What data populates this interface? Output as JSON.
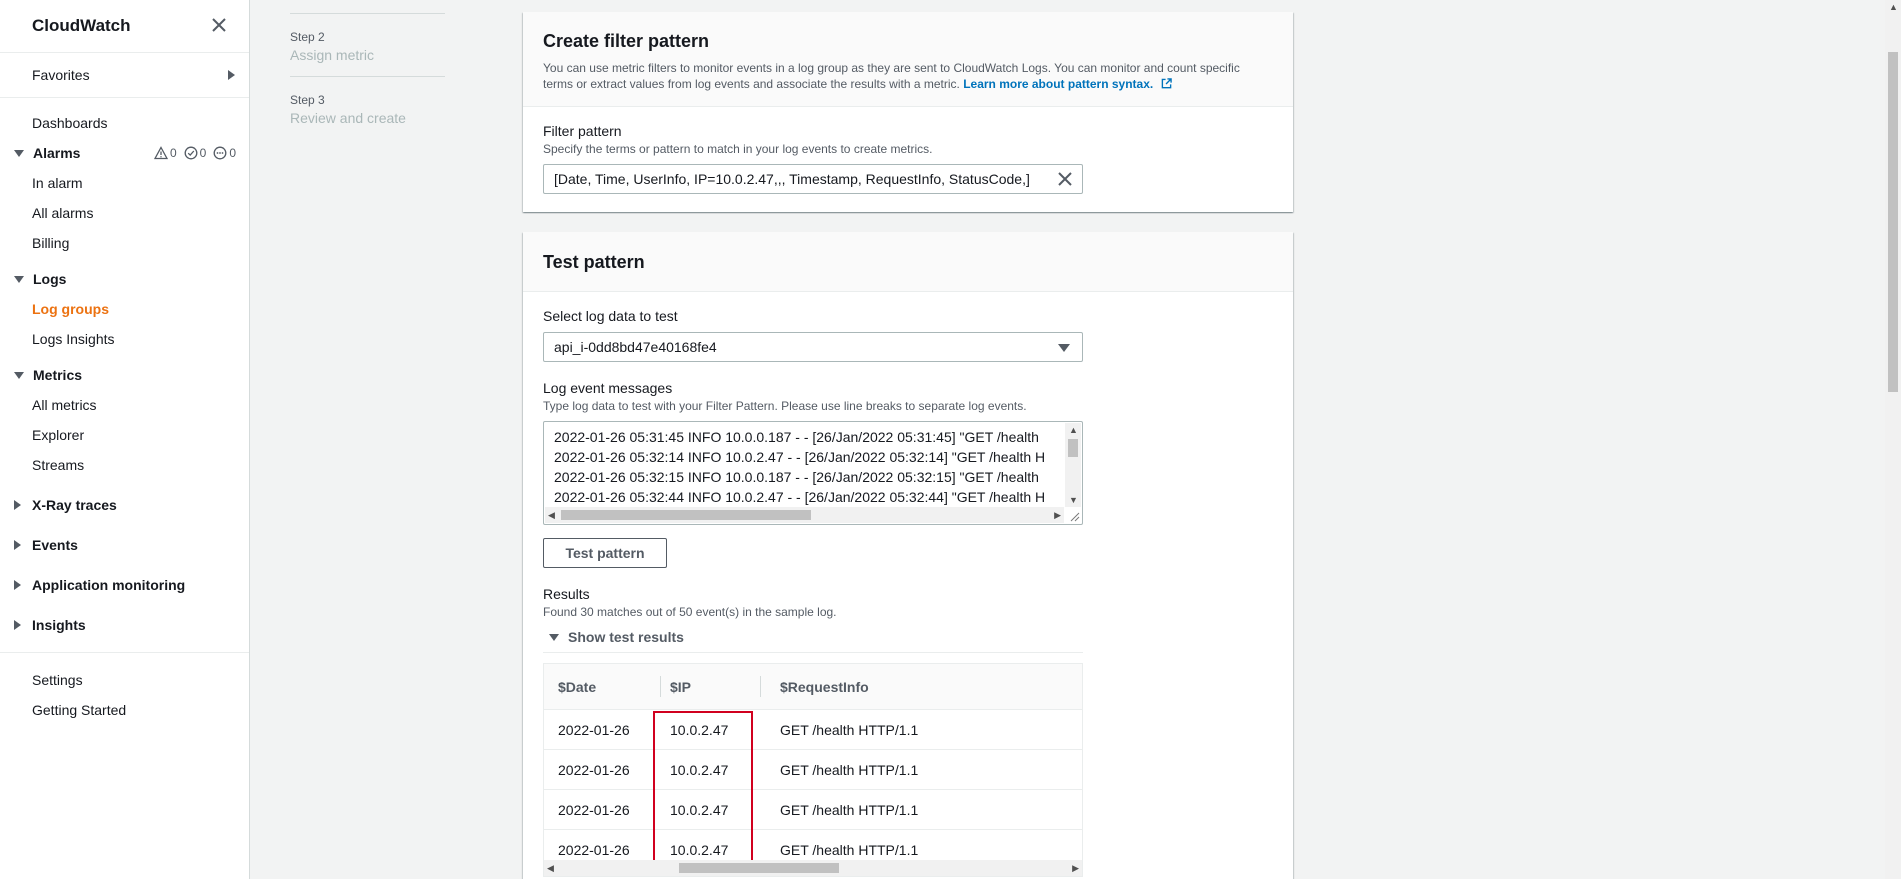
{
  "sidebar": {
    "title": "CloudWatch",
    "favorites": "Favorites",
    "dashboards": "Dashboards",
    "alarms": {
      "label": "Alarms",
      "counts": [
        "0",
        "0",
        "0"
      ],
      "items": [
        "In alarm",
        "All alarms",
        "Billing"
      ]
    },
    "logs": {
      "label": "Logs",
      "items": [
        "Log groups",
        "Logs Insights"
      ]
    },
    "metrics": {
      "label": "Metrics",
      "items": [
        "All metrics",
        "Explorer",
        "Streams"
      ]
    },
    "collapsed_sections": [
      "X-Ray traces",
      "Events",
      "Application monitoring",
      "Insights"
    ],
    "footer_links": [
      "Settings",
      "Getting Started"
    ]
  },
  "steps": [
    {
      "label": "Step 2",
      "name": "Assign metric"
    },
    {
      "label": "Step 3",
      "name": "Review and create"
    }
  ],
  "filter_panel": {
    "title": "Create filter pattern",
    "desc": "You can use metric filters to monitor events in a log group as they are sent to CloudWatch Logs. You can monitor and count specific terms or extract values from log events and associate the results with a metric.",
    "link": "Learn more about pattern syntax.",
    "field_label": "Filter pattern",
    "field_desc": "Specify the terms or pattern to match in your log events to create metrics.",
    "pattern_value": "[Date, Time, UserInfo, IP=10.0.2.47,,, Timestamp, RequestInfo, StatusCode,]"
  },
  "test_panel": {
    "title": "Test pattern",
    "select_label": "Select log data to test",
    "select_value": "api_i-0dd8bd47e40168fe4",
    "messages_label": "Log event messages",
    "messages_desc": "Type log data to test with your Filter Pattern. Please use line breaks to separate log events.",
    "log_lines": [
      "2022-01-26 05:31:45 INFO 10.0.0.187 - - [26/Jan/2022 05:31:45] \"GET /health",
      "2022-01-26 05:32:14 INFO 10.0.2.47 - - [26/Jan/2022 05:32:14] \"GET /health H",
      "2022-01-26 05:32:15 INFO 10.0.0.187 - - [26/Jan/2022 05:32:15] \"GET /health",
      "2022-01-26 05:32:44 INFO 10.0.2.47 - - [26/Jan/2022 05:32:44] \"GET /health H"
    ],
    "test_button": "Test pattern",
    "results_label": "Results",
    "results_summary": "Found 30 matches out of 50 event(s) in the sample log.",
    "show_results": "Show test results",
    "table": {
      "columns": [
        "$Date",
        "$IP",
        "$RequestInfo"
      ],
      "rows": [
        [
          "2022-01-26",
          "10.0.2.47",
          "GET /health HTTP/1.1"
        ],
        [
          "2022-01-26",
          "10.0.2.47",
          "GET /health HTTP/1.1"
        ],
        [
          "2022-01-26",
          "10.0.2.47",
          "GET /health HTTP/1.1"
        ],
        [
          "2022-01-26",
          "10.0.2.47",
          "GET /health HTTP/1.1"
        ]
      ]
    }
  },
  "colors": {
    "active_link": "#ec7211",
    "link": "#0073bb",
    "highlight": "#d1001f"
  }
}
